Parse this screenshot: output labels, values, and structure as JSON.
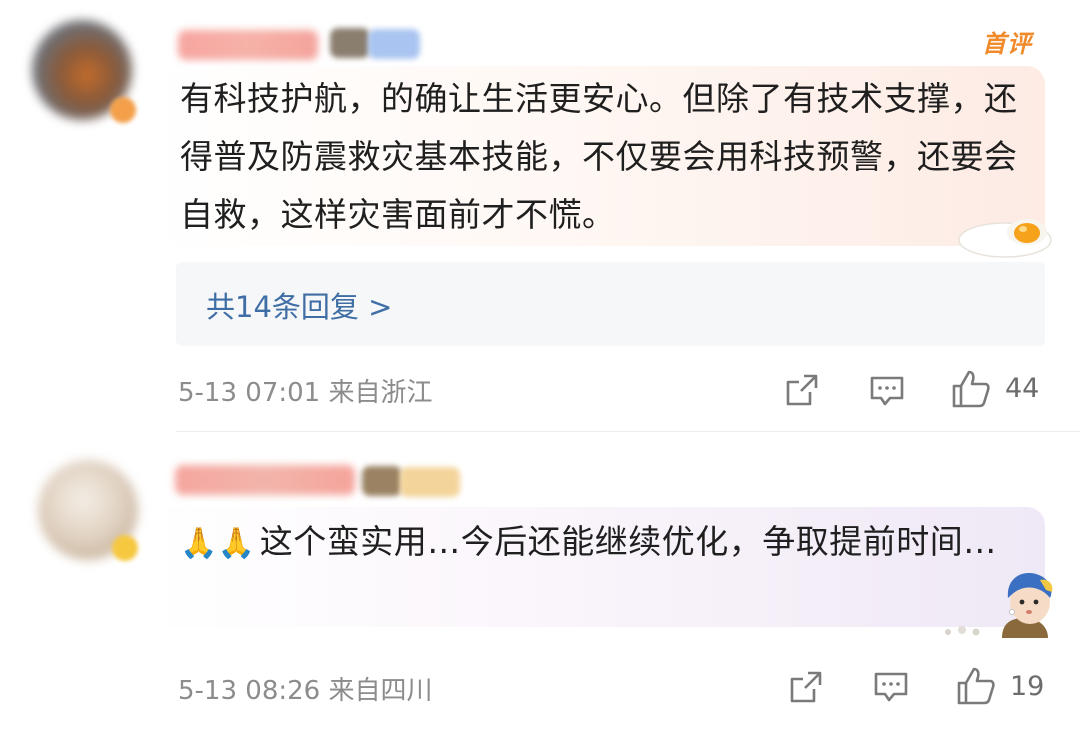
{
  "comments": [
    {
      "badge": "首评",
      "text": "有科技护航，的确让生活更安心。但除了有技术支撑，还得普及防震救灾基本技能，不仅要会用科技预警，还要会自救，这样灾害面前才不慌。",
      "replies_label": "共14条回复 >",
      "time": "5-13 07:01",
      "location": "来自浙江",
      "likes": "44",
      "icons": [
        "share-icon",
        "comment-icon",
        "like-icon"
      ]
    },
    {
      "emoji": "🙏🙏",
      "text": "这个蛮实用…今后还能继续优化，争取提前时间…",
      "time": "5-13 08:26",
      "location": "来自四川",
      "likes": "19",
      "icons": [
        "share-icon",
        "comment-icon",
        "like-icon"
      ]
    }
  ],
  "colors": {
    "badge": "#f08a2a",
    "reply_link": "#3f6ea5",
    "meta_text": "#8c8c8c"
  }
}
